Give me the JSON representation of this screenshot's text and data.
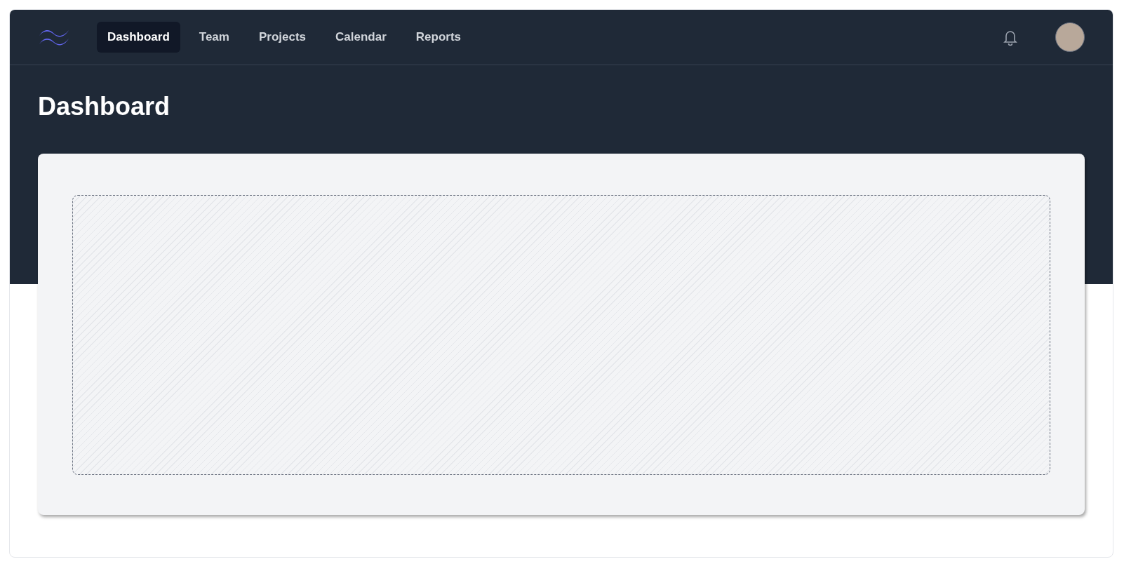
{
  "nav": {
    "items": [
      {
        "label": "Dashboard",
        "selected": true
      },
      {
        "label": "Team",
        "selected": false
      },
      {
        "label": "Projects",
        "selected": false
      },
      {
        "label": "Calendar",
        "selected": false
      },
      {
        "label": "Reports",
        "selected": false
      }
    ]
  },
  "header": {
    "title": "Dashboard"
  }
}
